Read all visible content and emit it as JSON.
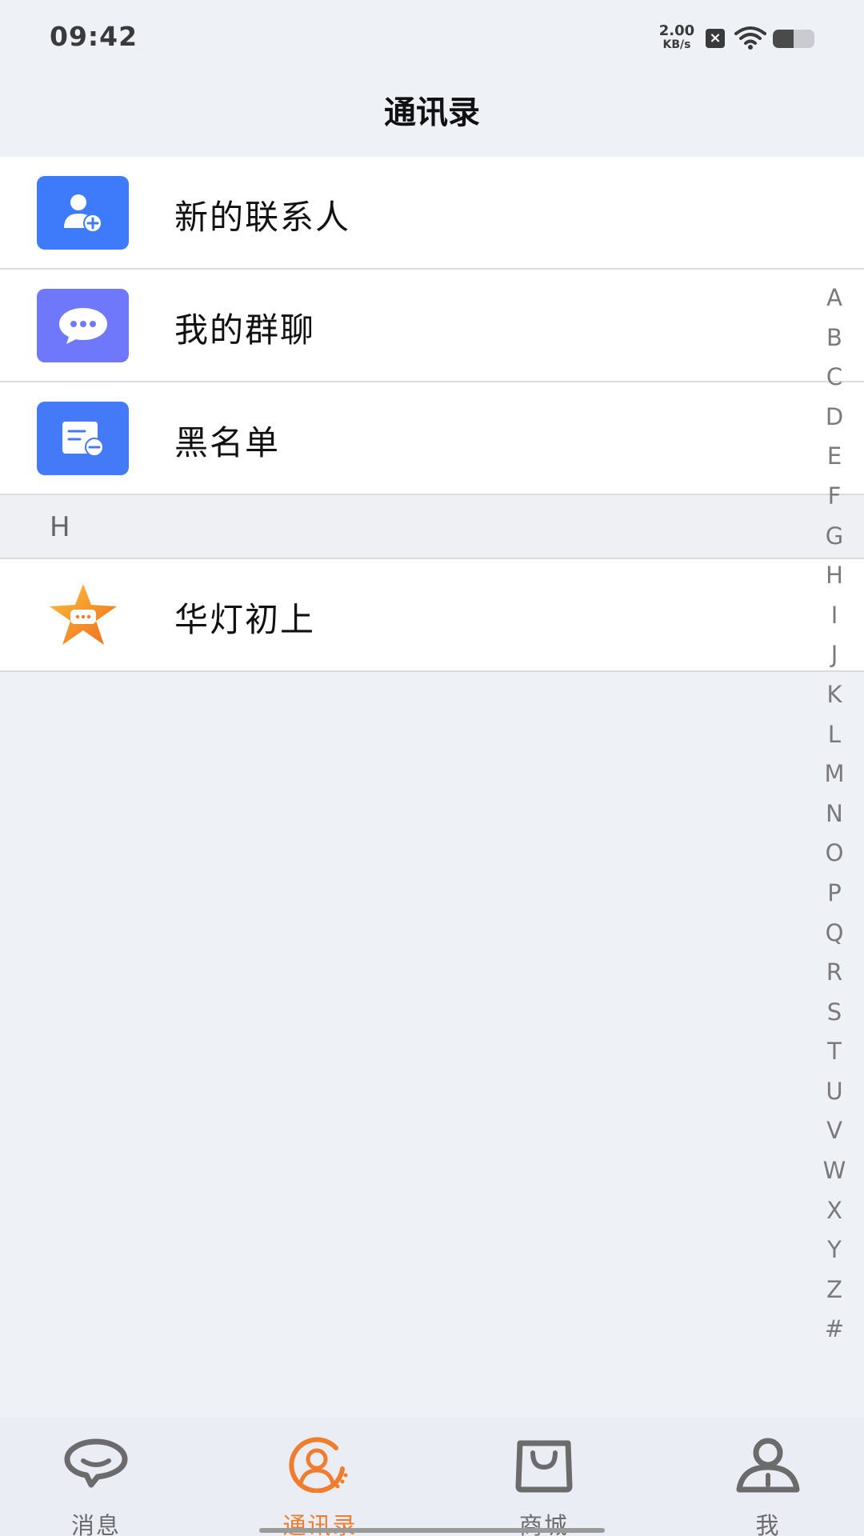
{
  "status_bar": {
    "time": "09:42",
    "net_speed_value": "2.00",
    "net_speed_unit": "KB/s",
    "sim_icon": "sim-disabled-icon",
    "battery_level": 0.5
  },
  "header": {
    "title": "通讯录"
  },
  "functions": [
    {
      "label": "新的联系人",
      "icon": "add-contact-icon",
      "color": "#3d7bfa"
    },
    {
      "label": "我的群聊",
      "icon": "group-chat-icon",
      "color": "#6f78fb"
    },
    {
      "label": "黑名单",
      "icon": "blacklist-icon",
      "color": "#4479f8"
    }
  ],
  "sections": [
    {
      "letter": "H",
      "contacts": [
        {
          "name": "华灯初上",
          "avatar": "star-chat-avatar-icon"
        }
      ]
    }
  ],
  "alphabet_index": [
    "A",
    "B",
    "C",
    "D",
    "E",
    "F",
    "G",
    "H",
    "I",
    "J",
    "K",
    "L",
    "M",
    "N",
    "O",
    "P",
    "Q",
    "R",
    "S",
    "T",
    "U",
    "V",
    "W",
    "X",
    "Y",
    "Z",
    "#"
  ],
  "tabs": [
    {
      "label": "消息",
      "icon": "message-icon",
      "active": false
    },
    {
      "label": "通讯录",
      "icon": "contacts-icon",
      "active": true
    },
    {
      "label": "商城",
      "icon": "shopping-bag-icon",
      "active": false
    },
    {
      "label": "我",
      "icon": "profile-icon",
      "active": false
    }
  ],
  "colors": {
    "accent": "#f07d2e",
    "tab_inactive": "#6b6b6b",
    "background": "#eef1f6"
  }
}
